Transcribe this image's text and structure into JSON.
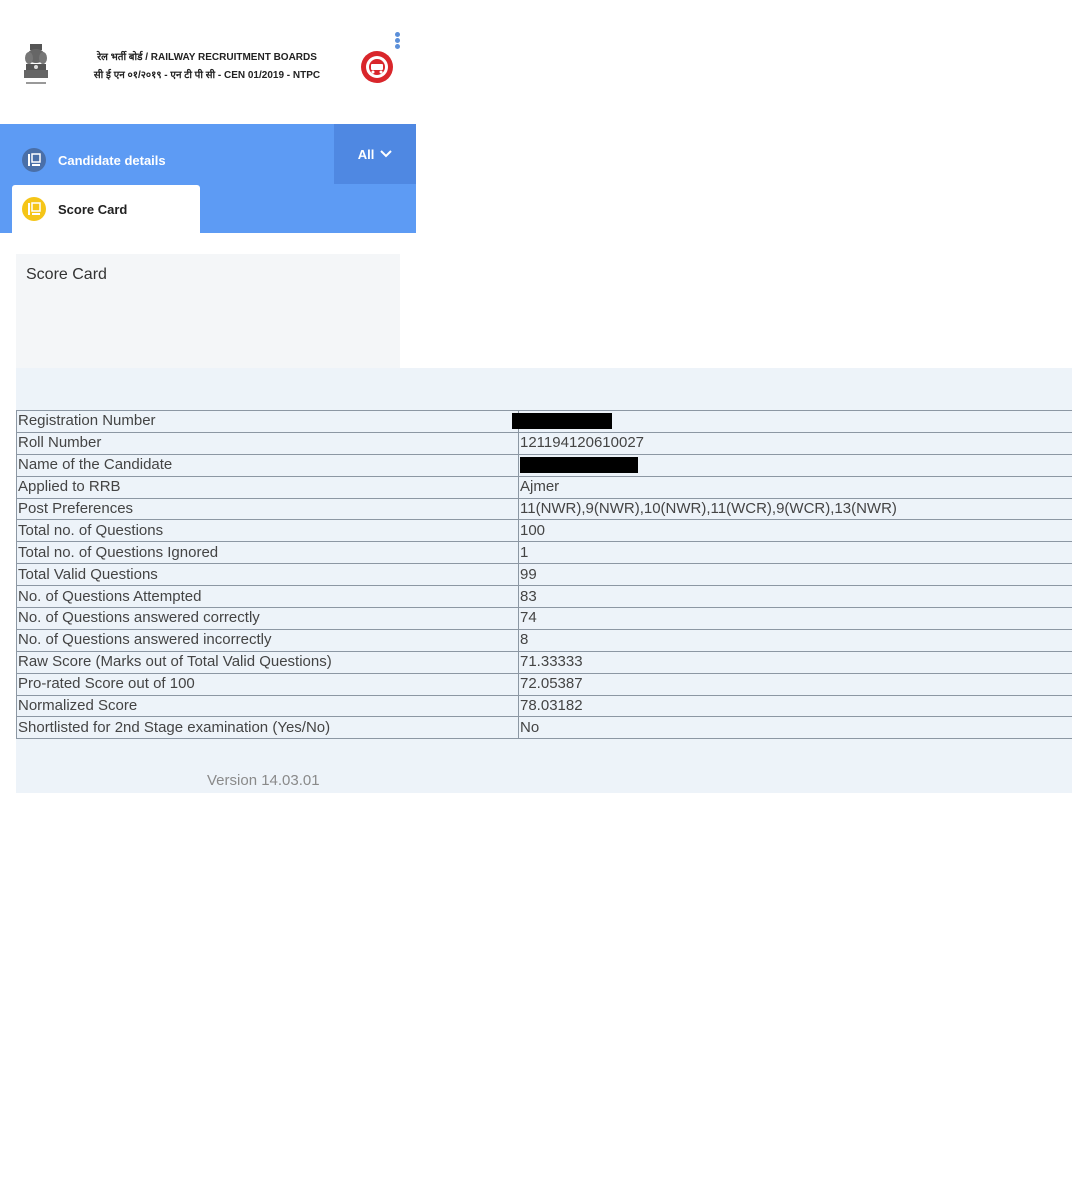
{
  "header": {
    "title_line1": "रेल भर्ती बोर्ड / RAILWAY RECRUITMENT BOARDS",
    "title_line2": "सी ई एन ०१/२०१९ - एन टी पी सी - CEN 01/2019 - NTPC"
  },
  "nav": {
    "candidate_details": "Candidate details",
    "score_card": "Score Card",
    "filter_label": "All"
  },
  "score_card": {
    "title": "Score Card",
    "rows": [
      {
        "label": "Registration Number",
        "value": ""
      },
      {
        "label": "Roll Number",
        "value": "121194120610027"
      },
      {
        "label": "Name of the Candidate",
        "value": ""
      },
      {
        "label": "Applied to RRB",
        "value": "Ajmer"
      },
      {
        "label": "Post Preferences",
        "value": "11(NWR),9(NWR),10(NWR),11(WCR),9(WCR),13(NWR)"
      },
      {
        "label": "Total no. of Questions",
        "value": "100"
      },
      {
        "label": "Total no. of Questions Ignored",
        "value": "1"
      },
      {
        "label": "Total Valid Questions",
        "value": "99"
      },
      {
        "label": "No. of Questions Attempted",
        "value": "83"
      },
      {
        "label": "No. of Questions answered correctly",
        "value": "74"
      },
      {
        "label": "No. of Questions answered incorrectly",
        "value": "8"
      },
      {
        "label": "Raw Score (Marks out of Total Valid Questions)",
        "value": "71.33333"
      },
      {
        "label": "Pro-rated Score out of 100",
        "value": "72.05387"
      },
      {
        "label": "Normalized Score",
        "value": "78.03182"
      },
      {
        "label": "Shortlisted for 2nd Stage examination (Yes/No)",
        "value": "No"
      }
    ]
  },
  "footer": {
    "version": "Version 14.03.01"
  },
  "colors": {
    "nav_blue": "#5d9bf4",
    "dropdown_blue": "#4f88e2",
    "score_icon_yellow": "#f5c518",
    "table_bg": "#edf3f9"
  },
  "icons": {
    "emblem": "national-emblem-icon",
    "rrb_logo": "railway-logo-icon",
    "menu": "kebab-menu-icon",
    "candidate": "id-card-icon",
    "score": "id-card-icon",
    "chevron": "chevron-down-icon"
  }
}
